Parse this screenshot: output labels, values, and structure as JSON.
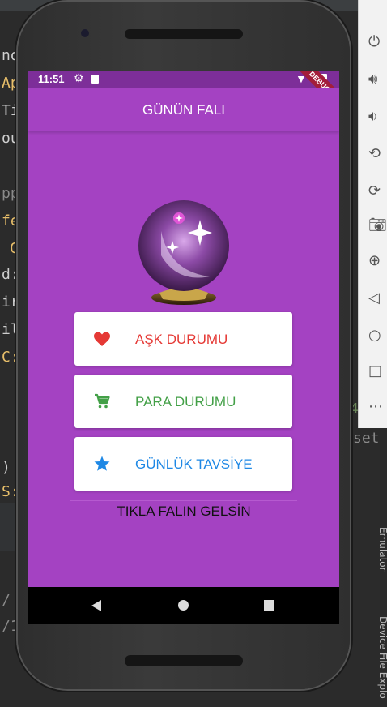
{
  "ide": {
    "code_lines": [
      "no",
      "Ap",
      "Ti",
      "ou",
      "pp",
      "fe",
      "C",
      "d:",
      "ir",
      "il",
      "C:",
      ")",
      "S:",
      "/",
      "/1:"
    ],
    "right_text": "set",
    "right_number": "4"
  },
  "emulator_toolbar": {
    "icons": [
      "power-icon",
      "volume-up-icon",
      "volume-down-icon",
      "rotate-left-icon",
      "rotate-right-icon",
      "camera-icon",
      "zoom-icon",
      "back-icon",
      "home-icon",
      "overview-icon",
      "more-icon"
    ],
    "side_labels": [
      "Emulator",
      "Device File Explo"
    ]
  },
  "status_bar": {
    "time": "11:51"
  },
  "debug_banner": "DEBUG",
  "app_bar": {
    "title": "GÜNÜN FALI"
  },
  "colors": {
    "primary": "#a442c2",
    "status_bar": "#7d2e99",
    "love": "#e53935",
    "money": "#43a047",
    "advice": "#1e88e5"
  },
  "buttons": [
    {
      "label": "AŞK DURUMU",
      "icon": "heart-icon"
    },
    {
      "label": "PARA DURUMU",
      "icon": "shopping-cart-icon"
    },
    {
      "label": "GÜNLÜK TAVSİYE",
      "icon": "star-icon"
    }
  ],
  "footer_text": "TIKLA FALIN GELSİN"
}
